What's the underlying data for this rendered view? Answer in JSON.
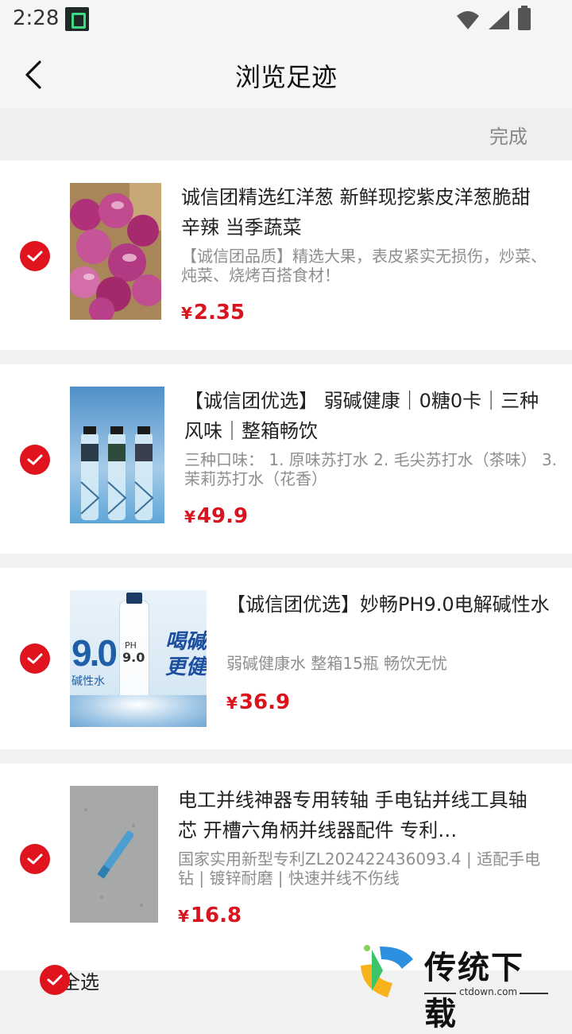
{
  "status": {
    "time": "2:28"
  },
  "header": {
    "title": "浏览足迹",
    "done_label": "完成"
  },
  "items": [
    {
      "title": "诚信团精选红洋葱 新鲜现挖紫皮洋葱脆甜辛辣 当季蔬菜",
      "desc": "【诚信团品质】精选大果，表皮紧实无损伤，炒菜、炖菜、烧烤百搭食材！",
      "currency": "¥",
      "price": "2.35"
    },
    {
      "title": "【诚信团优选】 弱碱健康｜0糖0卡｜三种风味｜整箱畅饮",
      "desc": "三种口味： 1. 原味苏打水 2. 毛尖苏打水（茶味） 3. 茉莉苏打水（花香）",
      "currency": "¥",
      "price": "49.9"
    },
    {
      "title": "【诚信团优选】妙畅PH9.0电解碱性水",
      "desc": "弱碱健康水 整箱15瓶 畅饮无忧",
      "currency": "¥",
      "price": "36.9",
      "image_text": {
        "big": "9.0",
        "left_caption": "碱性水",
        "right_line1": "喝碱",
        "right_line2": "更健",
        "bottle_ph": "PH",
        "bottle_val": "9.0"
      }
    },
    {
      "title": "电工并线神器专用转轴 手电钻并线工具轴芯 开槽六角柄并线器配件 专利…",
      "desc": "国家实用新型专利ZL202422436093.4 | 适配手电钻 | 镀锌耐磨 | 快速并线不伤线",
      "currency": "¥",
      "price": "16.8"
    }
  ],
  "footer": {
    "select_all_label": "全选"
  },
  "watermark": {
    "text": "传统下载",
    "url": "ctdown.com"
  },
  "colors": {
    "accent": "#e0141e",
    "price": "#d9141f"
  }
}
